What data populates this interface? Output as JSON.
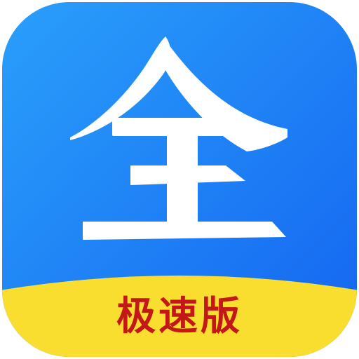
{
  "app_icon": {
    "glyph_label": "全",
    "badge_label": "极速版",
    "colors": {
      "blue_light": "#2aa0fb",
      "blue_dark": "#1464f0",
      "banner_yellow": "#f9dd2f",
      "glyph_white": "#ffffff",
      "badge_text_red": "#c41717"
    }
  }
}
